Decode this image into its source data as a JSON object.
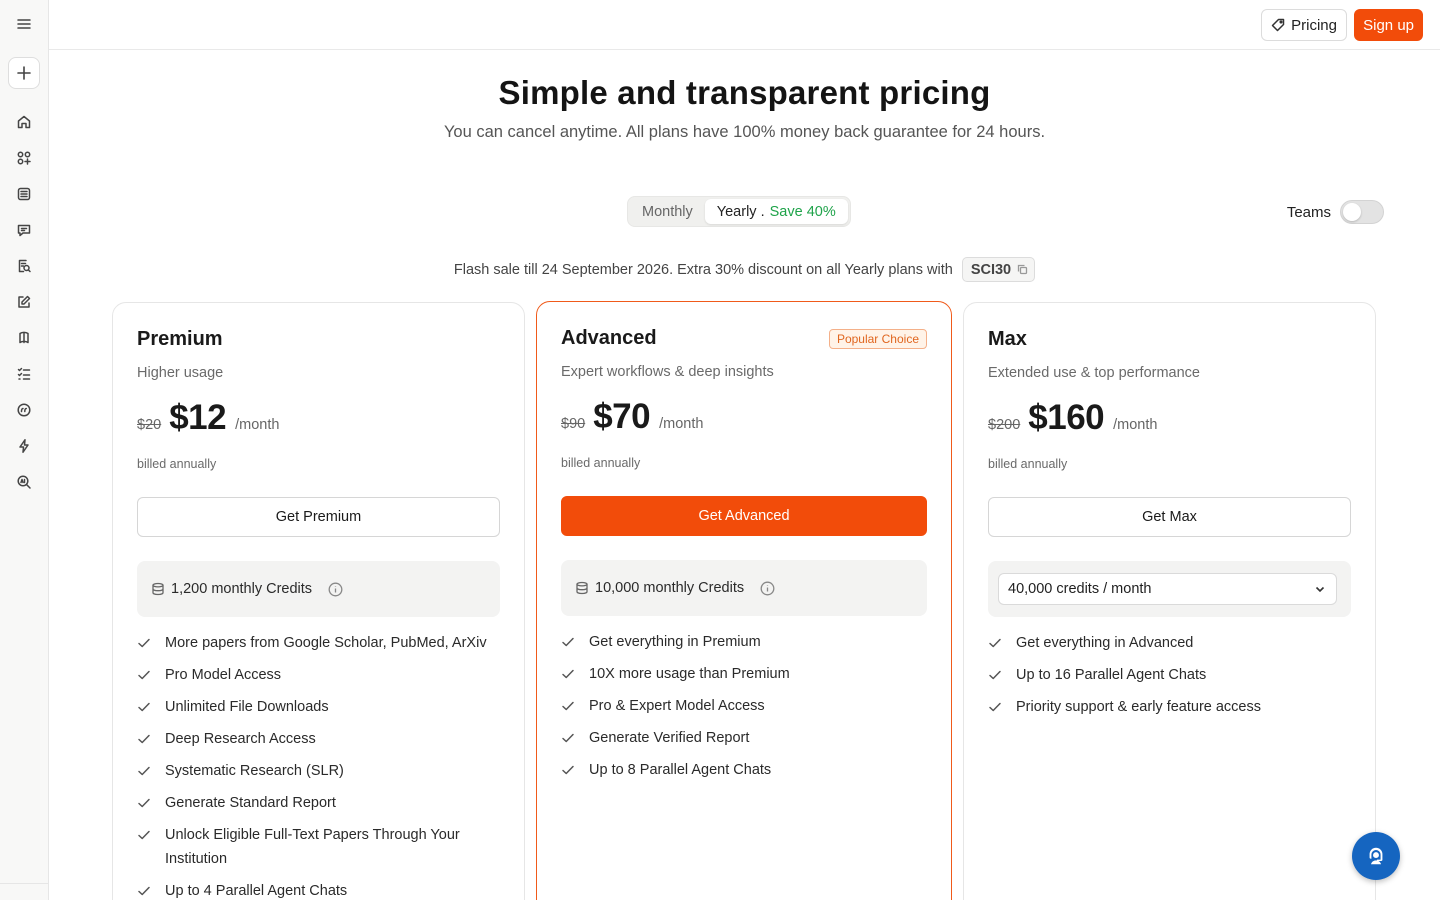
{
  "topbar": {
    "pricing_label": "Pricing",
    "signup_label": "Sign up"
  },
  "hero": {
    "title": "Simple and transparent pricing",
    "subtitle": "You can cancel anytime. All plans have 100% money back guarantee for 24 hours."
  },
  "billing": {
    "monthly_label": "Monthly",
    "yearly_label": "Yearly .",
    "yearly_save": "Save 40%",
    "selected": "Yearly"
  },
  "teams": {
    "label": "Teams",
    "enabled": false
  },
  "flash_sale": {
    "text": "Flash sale till 24 September 2026. Extra 30% discount on all Yearly plans with",
    "code": "SCI30"
  },
  "plans": [
    {
      "name": "Premium",
      "description": "Higher usage",
      "old_price": "$20",
      "price": "$12",
      "period": "/month",
      "billed": "billed annually",
      "cta": "Get Premium",
      "credits": "1,200 monthly Credits",
      "features": [
        "More papers from Google Scholar, PubMed, ArXiv",
        "Pro Model Access",
        "Unlimited File Downloads",
        "Deep Research Access",
        "Systematic Research (SLR)",
        "Generate Standard Report",
        "Unlock Eligible Full-Text Papers Through Your Institution",
        "Up to 4 Parallel Agent Chats"
      ]
    },
    {
      "name": "Advanced",
      "badge": "Popular Choice",
      "description": "Expert workflows & deep insights",
      "old_price": "$90",
      "price": "$70",
      "period": "/month",
      "billed": "billed annually",
      "cta": "Get Advanced",
      "credits": "10,000 monthly Credits",
      "features": [
        "Get everything in Premium",
        "10X more usage than Premium",
        "Pro & Expert Model Access",
        "Generate Verified Report",
        "Up to 8 Parallel Agent Chats"
      ]
    },
    {
      "name": "Max",
      "description": "Extended use & top performance",
      "old_price": "$200",
      "price": "$160",
      "period": "/month",
      "billed": "billed annually",
      "cta": "Get Max",
      "credits_select": "40,000 credits / month",
      "features": [
        "Get everything in Advanced",
        "Up to 16 Parallel Agent Chats",
        "Priority support & early feature access"
      ]
    }
  ],
  "sidebar": {
    "icons": [
      "menu-icon",
      "new-chat-icon",
      "home-icon",
      "apps-icon",
      "library-icon",
      "chat-icon",
      "search-doc-icon",
      "write-icon",
      "notebook-icon",
      "list-icon",
      "citation-icon",
      "bolt-icon",
      "ai-detector-icon"
    ]
  },
  "colors": {
    "brand": "#f24c0a",
    "save_green": "#1fa34a",
    "chat_blue": "#1565c0"
  }
}
